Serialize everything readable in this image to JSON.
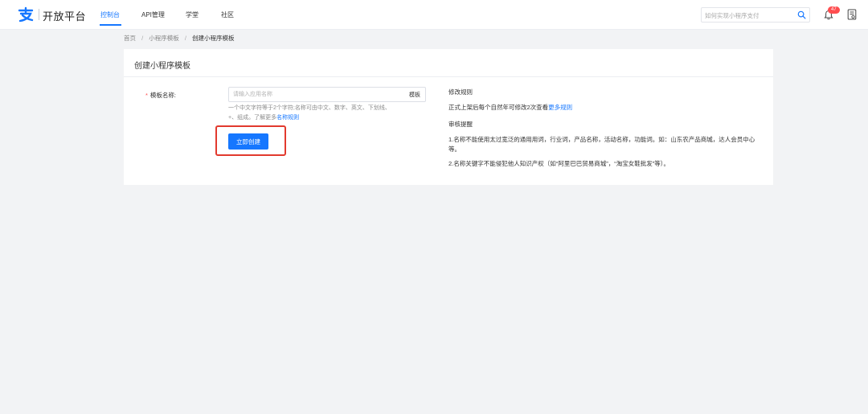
{
  "header": {
    "brand": "开放平台",
    "nav": [
      "控制台",
      "API管理",
      "学堂",
      "社区"
    ],
    "active_nav_index": 0,
    "search_placeholder": "如何实现小程序支付",
    "notification_count": "47",
    "accent_color": "#1677ff"
  },
  "breadcrumb": {
    "items": [
      "首页",
      "小程序模板",
      "创建小程序模板"
    ],
    "separator": "/"
  },
  "card": {
    "title": "创建小程序模板",
    "form": {
      "required_mark": "*",
      "name_label": "模板名称:",
      "name_value": "",
      "name_placeholder": "请输入应用名称",
      "name_suffix": "模板",
      "help_line1": "一个中文字符等于2个字符;名称可由中文、数字、英文、下划线、",
      "help_line2_prefix": "+、组成。了解更多",
      "help_link": "名称规则",
      "submit_label": "立即创建"
    },
    "rules": {
      "modify_heading": "修改规则",
      "modify_text": "正式上架后每个自然年可修改2次查看",
      "modify_link": "更多规则",
      "review_heading": "审核提醒",
      "review_item1": "1.名称不能使用太过宽泛的通用用词，行业词，产品名称，活动名称，功能词。如：山东农产品商城，达人会员中心等。",
      "review_item2": "2.名称关键字不能侵犯他人知识产权（如“阿里巴巴贸易商城”，“淘宝女鞋批发”等）。"
    }
  }
}
